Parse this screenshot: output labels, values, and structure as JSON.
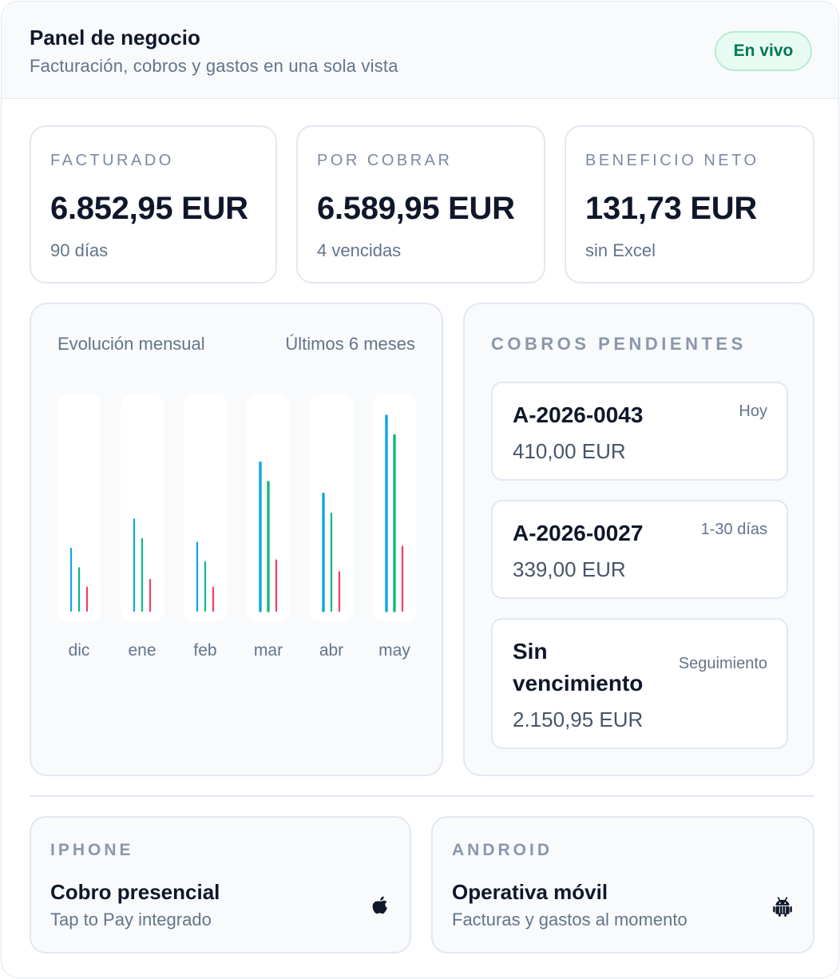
{
  "header": {
    "title": "Panel de negocio",
    "subtitle": "Facturación, cobros y gastos en una sola vista",
    "badge": "En vivo"
  },
  "kpis": [
    {
      "label": "FACTURADO",
      "value": "6.852,95 EUR",
      "note": "90 días"
    },
    {
      "label": "POR COBRAR",
      "value": "6.589,95 EUR",
      "note": "4 vencidas"
    },
    {
      "label": "BENEFICIO NETO",
      "value": "131,73 EUR",
      "note": "sin Excel"
    }
  ],
  "chart": {
    "title": "Evolución mensual",
    "range": "Últimos 6 meses"
  },
  "chart_data": {
    "type": "bar",
    "categories": [
      "dic",
      "ene",
      "feb",
      "mar",
      "abr",
      "may"
    ],
    "series": [
      {
        "color": "#0ea5e9",
        "values": [
          32,
          47,
          35,
          76,
          60,
          100
        ]
      },
      {
        "color": "#10b981",
        "values": [
          22,
          37,
          25,
          66,
          50,
          90
        ]
      },
      {
        "color": "#f43f5e",
        "values": [
          12,
          16,
          12,
          26,
          20,
          33
        ]
      }
    ],
    "ylim": [
      0,
      100
    ],
    "grid": false,
    "legend": "none"
  },
  "pending": {
    "title": "COBROS PENDIENTES",
    "items": [
      {
        "id": "A-2026-0043",
        "when": "Hoy",
        "amount": "410,00 EUR"
      },
      {
        "id": "A-2026-0027",
        "when": "1-30 días",
        "amount": "339,00 EUR"
      },
      {
        "id": "Sin vencimiento",
        "when": "Seguimiento",
        "amount": "2.150,95 EUR"
      }
    ]
  },
  "devices": [
    {
      "label": "IPHONE",
      "title": "Cobro presencial",
      "subtitle": "Tap to Pay integrado",
      "icon": "apple-icon"
    },
    {
      "label": "ANDROID",
      "title": "Operativa móvil",
      "subtitle": "Facturas y gastos al momento",
      "icon": "android-icon"
    }
  ]
}
